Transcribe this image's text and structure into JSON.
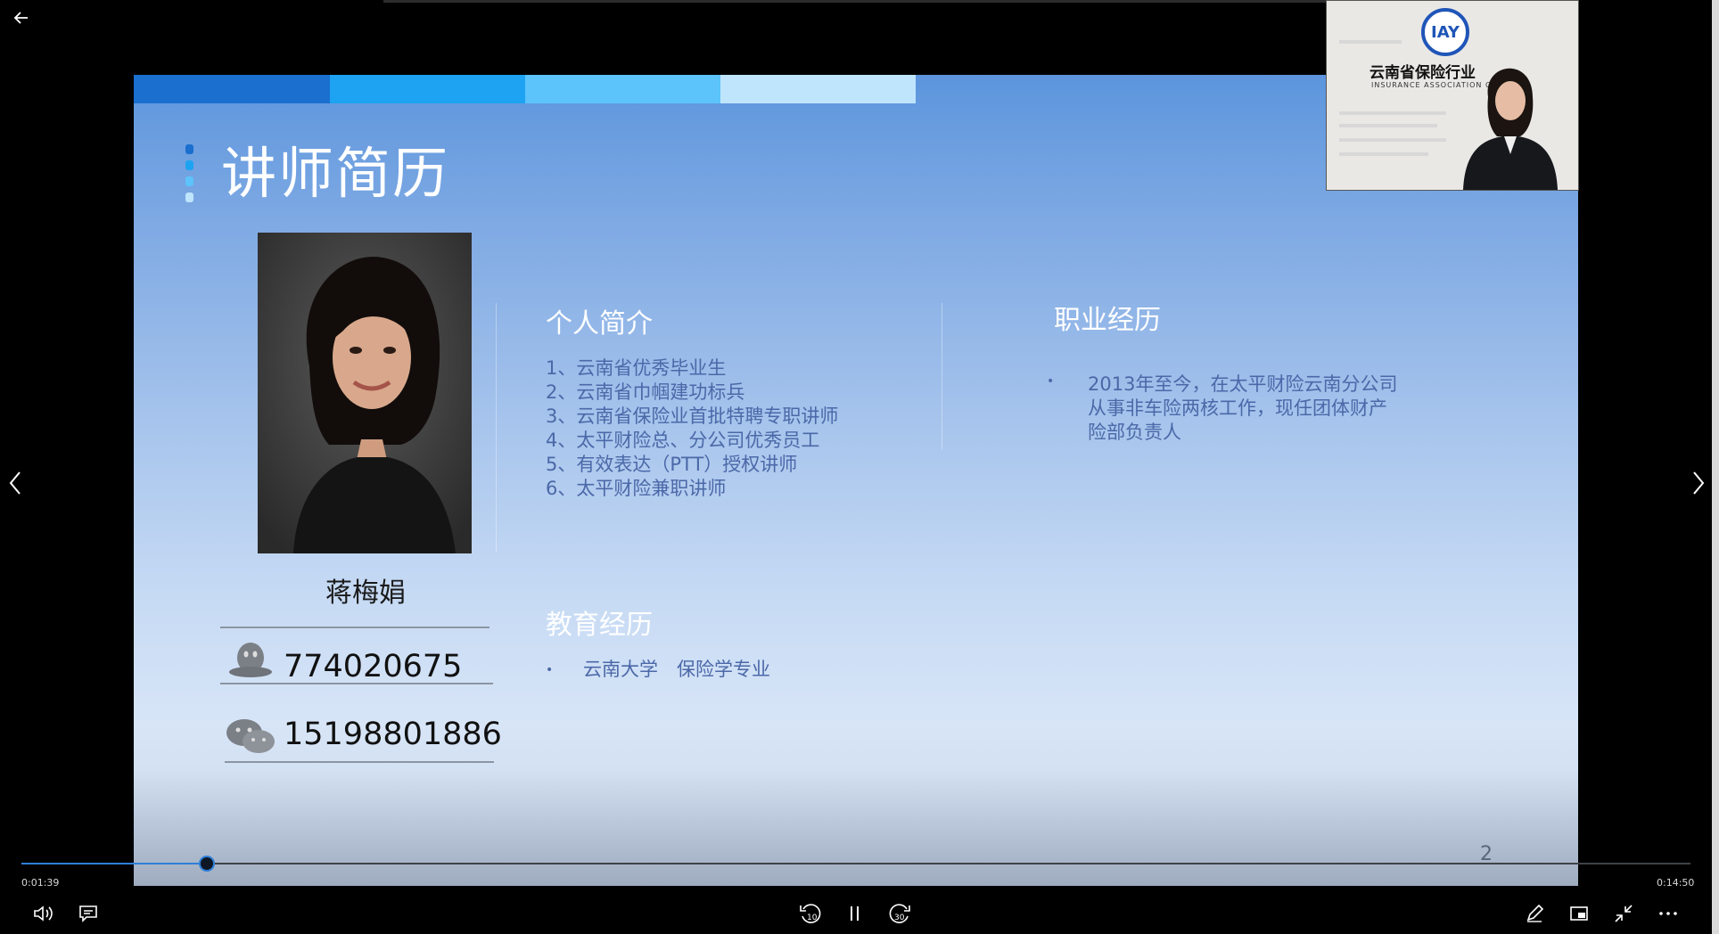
{
  "player": {
    "current_time": "0:01:39",
    "total_time": "0:14:50",
    "progress": 0.111
  },
  "slide": {
    "title": "讲师简历",
    "instructor_name": "蒋梅娟",
    "qq_number": "774020675",
    "wechat_number": "15198801886",
    "profile": {
      "title": "个人简介",
      "items": [
        "1、云南省优秀毕业生",
        "2、云南省巾帼建功标兵",
        "3、云南省保险业首批特聘专职讲师",
        "4、太平财险总、分公司优秀员工",
        "5、有效表达（PTT）授权讲师",
        "6、太平财险兼职讲师"
      ]
    },
    "education": {
      "title": "教育经历",
      "items": [
        "云南大学　保险学专业"
      ]
    },
    "career": {
      "title": "职业经历",
      "items": [
        "2013年至今，在太平财险云南分公司从事非车险两核工作，现任团体财产险部负责人"
      ]
    },
    "page_number": "2"
  },
  "pip": {
    "logo_text": "IAY",
    "org_name": "云南省保险行业",
    "org_sub": "INSURANCE ASSOCIATION OF"
  },
  "colors": {
    "accent": "#2f7fd8",
    "strip_1": "#1a6fcf",
    "strip_2": "#1ea3f2",
    "strip_3": "#5cc3fb",
    "strip_4": "#bfe5fd",
    "list_text": "#4b68a8"
  },
  "icons": [
    "back-arrow-icon",
    "prev-slide-icon",
    "next-slide-icon",
    "volume-icon",
    "subtitles-icon",
    "rewind-10-icon",
    "pause-icon",
    "forward-30-icon",
    "pen-icon",
    "mini-player-icon",
    "exit-fullscreen-icon",
    "more-icon",
    "qq-icon",
    "wechat-icon"
  ]
}
